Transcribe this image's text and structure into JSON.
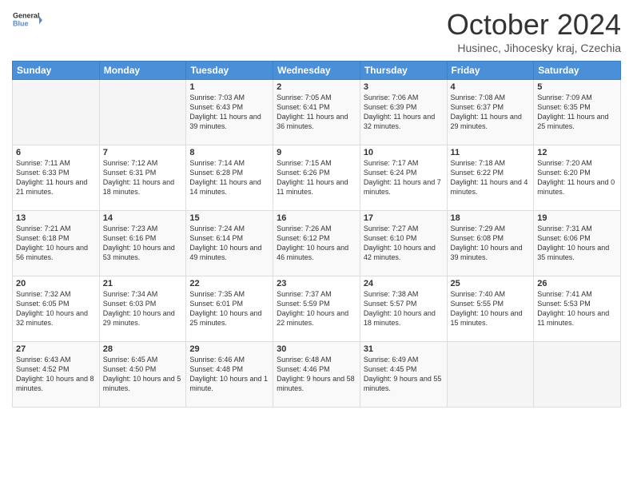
{
  "header": {
    "logo_text_general": "General",
    "logo_text_blue": "Blue",
    "month_title": "October 2024",
    "location": "Husinec, Jihocesky kraj, Czechia"
  },
  "days_of_week": [
    "Sunday",
    "Monday",
    "Tuesday",
    "Wednesday",
    "Thursday",
    "Friday",
    "Saturday"
  ],
  "weeks": [
    {
      "days": [
        {
          "date": "",
          "info": ""
        },
        {
          "date": "",
          "info": ""
        },
        {
          "date": "1",
          "info": "Sunrise: 7:03 AM\nSunset: 6:43 PM\nDaylight: 11 hours and 39 minutes."
        },
        {
          "date": "2",
          "info": "Sunrise: 7:05 AM\nSunset: 6:41 PM\nDaylight: 11 hours and 36 minutes."
        },
        {
          "date": "3",
          "info": "Sunrise: 7:06 AM\nSunset: 6:39 PM\nDaylight: 11 hours and 32 minutes."
        },
        {
          "date": "4",
          "info": "Sunrise: 7:08 AM\nSunset: 6:37 PM\nDaylight: 11 hours and 29 minutes."
        },
        {
          "date": "5",
          "info": "Sunrise: 7:09 AM\nSunset: 6:35 PM\nDaylight: 11 hours and 25 minutes."
        }
      ]
    },
    {
      "days": [
        {
          "date": "6",
          "info": "Sunrise: 7:11 AM\nSunset: 6:33 PM\nDaylight: 11 hours and 21 minutes."
        },
        {
          "date": "7",
          "info": "Sunrise: 7:12 AM\nSunset: 6:31 PM\nDaylight: 11 hours and 18 minutes."
        },
        {
          "date": "8",
          "info": "Sunrise: 7:14 AM\nSunset: 6:28 PM\nDaylight: 11 hours and 14 minutes."
        },
        {
          "date": "9",
          "info": "Sunrise: 7:15 AM\nSunset: 6:26 PM\nDaylight: 11 hours and 11 minutes."
        },
        {
          "date": "10",
          "info": "Sunrise: 7:17 AM\nSunset: 6:24 PM\nDaylight: 11 hours and 7 minutes."
        },
        {
          "date": "11",
          "info": "Sunrise: 7:18 AM\nSunset: 6:22 PM\nDaylight: 11 hours and 4 minutes."
        },
        {
          "date": "12",
          "info": "Sunrise: 7:20 AM\nSunset: 6:20 PM\nDaylight: 11 hours and 0 minutes."
        }
      ]
    },
    {
      "days": [
        {
          "date": "13",
          "info": "Sunrise: 7:21 AM\nSunset: 6:18 PM\nDaylight: 10 hours and 56 minutes."
        },
        {
          "date": "14",
          "info": "Sunrise: 7:23 AM\nSunset: 6:16 PM\nDaylight: 10 hours and 53 minutes."
        },
        {
          "date": "15",
          "info": "Sunrise: 7:24 AM\nSunset: 6:14 PM\nDaylight: 10 hours and 49 minutes."
        },
        {
          "date": "16",
          "info": "Sunrise: 7:26 AM\nSunset: 6:12 PM\nDaylight: 10 hours and 46 minutes."
        },
        {
          "date": "17",
          "info": "Sunrise: 7:27 AM\nSunset: 6:10 PM\nDaylight: 10 hours and 42 minutes."
        },
        {
          "date": "18",
          "info": "Sunrise: 7:29 AM\nSunset: 6:08 PM\nDaylight: 10 hours and 39 minutes."
        },
        {
          "date": "19",
          "info": "Sunrise: 7:31 AM\nSunset: 6:06 PM\nDaylight: 10 hours and 35 minutes."
        }
      ]
    },
    {
      "days": [
        {
          "date": "20",
          "info": "Sunrise: 7:32 AM\nSunset: 6:05 PM\nDaylight: 10 hours and 32 minutes."
        },
        {
          "date": "21",
          "info": "Sunrise: 7:34 AM\nSunset: 6:03 PM\nDaylight: 10 hours and 29 minutes."
        },
        {
          "date": "22",
          "info": "Sunrise: 7:35 AM\nSunset: 6:01 PM\nDaylight: 10 hours and 25 minutes."
        },
        {
          "date": "23",
          "info": "Sunrise: 7:37 AM\nSunset: 5:59 PM\nDaylight: 10 hours and 22 minutes."
        },
        {
          "date": "24",
          "info": "Sunrise: 7:38 AM\nSunset: 5:57 PM\nDaylight: 10 hours and 18 minutes."
        },
        {
          "date": "25",
          "info": "Sunrise: 7:40 AM\nSunset: 5:55 PM\nDaylight: 10 hours and 15 minutes."
        },
        {
          "date": "26",
          "info": "Sunrise: 7:41 AM\nSunset: 5:53 PM\nDaylight: 10 hours and 11 minutes."
        }
      ]
    },
    {
      "days": [
        {
          "date": "27",
          "info": "Sunrise: 6:43 AM\nSunset: 4:52 PM\nDaylight: 10 hours and 8 minutes."
        },
        {
          "date": "28",
          "info": "Sunrise: 6:45 AM\nSunset: 4:50 PM\nDaylight: 10 hours and 5 minutes."
        },
        {
          "date": "29",
          "info": "Sunrise: 6:46 AM\nSunset: 4:48 PM\nDaylight: 10 hours and 1 minute."
        },
        {
          "date": "30",
          "info": "Sunrise: 6:48 AM\nSunset: 4:46 PM\nDaylight: 9 hours and 58 minutes."
        },
        {
          "date": "31",
          "info": "Sunrise: 6:49 AM\nSunset: 4:45 PM\nDaylight: 9 hours and 55 minutes."
        },
        {
          "date": "",
          "info": ""
        },
        {
          "date": "",
          "info": ""
        }
      ]
    }
  ]
}
